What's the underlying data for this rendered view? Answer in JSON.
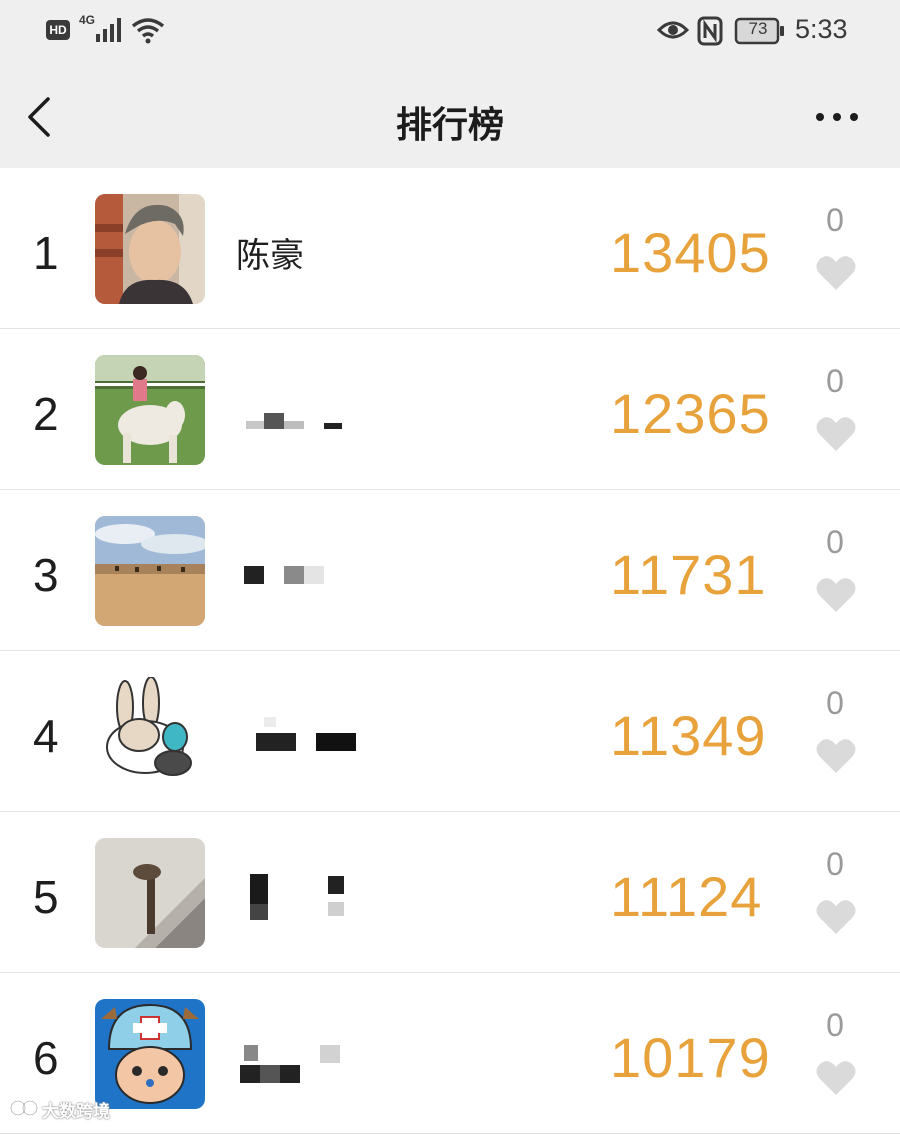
{
  "status_bar": {
    "hd_badge": "HD",
    "network": "4G",
    "battery": "73",
    "time": "5:33"
  },
  "nav": {
    "title": "排行榜",
    "back_icon": "chevron-left-icon",
    "more_icon": "more-horizontal-icon"
  },
  "accent_color": "#e8a23c",
  "ranking": [
    {
      "rank": "1",
      "name": "陈豪",
      "score": "13405",
      "likes": "0"
    },
    {
      "rank": "2",
      "name": "",
      "score": "12365",
      "likes": "0"
    },
    {
      "rank": "3",
      "name": "",
      "score": "11731",
      "likes": "0"
    },
    {
      "rank": "4",
      "name": "",
      "score": "11349",
      "likes": "0"
    },
    {
      "rank": "5",
      "name": "",
      "score": "11124",
      "likes": "0"
    },
    {
      "rank": "6",
      "name": "",
      "score": "10179",
      "likes": "0"
    }
  ],
  "watermark": "大数跨境"
}
